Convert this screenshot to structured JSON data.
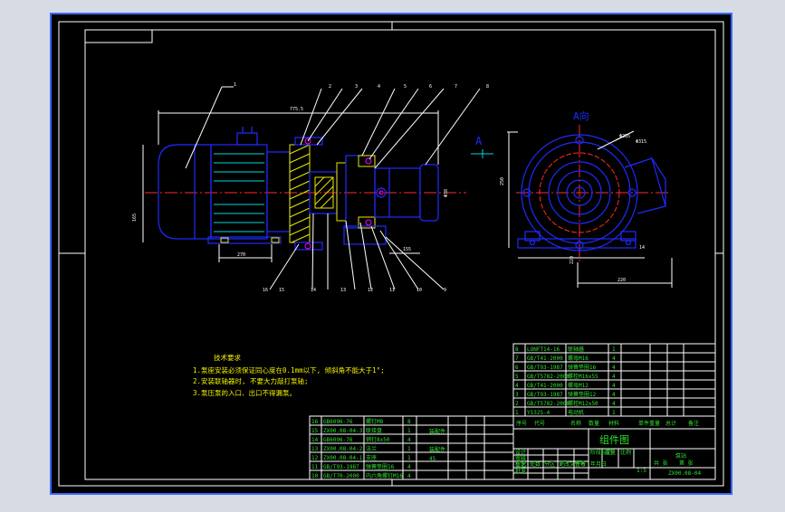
{
  "drawing": {
    "balloons": [
      "1",
      "2",
      "3",
      "4",
      "5",
      "6",
      "7",
      "8",
      "9",
      "10",
      "11",
      "12",
      "13",
      "14",
      "15",
      "16"
    ],
    "view_label": "A向",
    "view_arrow_label": "A",
    "dimensions": [
      "220",
      "Φ315",
      "Φ285",
      "Φ38",
      "220",
      "155",
      "250",
      "14"
    ],
    "left_dims": [
      "775.5",
      "165",
      "270"
    ]
  },
  "tech_notes": {
    "title": "技术要求",
    "items": [
      "1.泵座安装必须保证同心度在0.1mm以下, 倾斜角不能大于1°;",
      "2.安装联轴器时, 不要大力敲打泵轴;",
      "3.泵压泵的入口、出口不得漏泵。"
    ]
  },
  "parts_upper": [
    {
      "no": "8",
      "code": "LONFT14-16",
      "name": "联轴器",
      "qty": "1"
    },
    {
      "no": "7",
      "code": "GB/T41-2000",
      "name": "螺母M16",
      "qty": "4"
    },
    {
      "no": "6",
      "code": "GB/T93-1987",
      "name": "弹簧垫圈16",
      "qty": "4"
    },
    {
      "no": "5",
      "code": "GB/T5782-2000",
      "name": "螺栓M16x55",
      "qty": "4"
    },
    {
      "no": "4",
      "code": "GB/T41-2000",
      "name": "螺母M12",
      "qty": "4"
    },
    {
      "no": "3",
      "code": "GB/T93-1987",
      "name": "弹簧垫圈12",
      "qty": "4"
    },
    {
      "no": "2",
      "code": "GB/T5782-2000",
      "name": "螺栓M12x50",
      "qty": "4"
    },
    {
      "no": "1",
      "code": "Y132S-4",
      "name": "电动机",
      "qty": "1"
    }
  ],
  "parts_header": [
    "序号",
    "代号",
    "名称",
    "数量",
    "材料",
    "单件重量",
    "总计",
    "备注"
  ],
  "parts_lower": [
    {
      "no": "16",
      "code": "GB6096-76",
      "name": "螺钉M8",
      "qty": "8",
      "note": ""
    },
    {
      "no": "15",
      "code": "ZX00.08-04-3",
      "name": "联接盘",
      "qty": "1",
      "note": "装配件"
    },
    {
      "no": "14",
      "code": "GB6096-76",
      "name": "销钉8x50",
      "qty": "4",
      "note": ""
    },
    {
      "no": "13",
      "code": "ZX00.08-04-2",
      "name": "法兰",
      "qty": "1",
      "note": "装配件"
    },
    {
      "no": "12",
      "code": "ZX00.08-04-1",
      "name": "支座",
      "qty": "1",
      "note": "45"
    },
    {
      "no": "11",
      "code": "GB/T93-1987",
      "name": "弹簧垫圈16",
      "qty": "4",
      "note": ""
    },
    {
      "no": "10",
      "code": "GB/T70-2000",
      "name": "内六角螺钉M16",
      "qty": "4",
      "note": ""
    }
  ],
  "title_block": {
    "drawing_name": "组件图",
    "company": "泵站",
    "drawing_no": "ZX00.08-04",
    "scale": "1:5",
    "rows": [
      "标记",
      "处数",
      "分区",
      "更改文件号",
      "签名",
      "年月日"
    ],
    "roles": [
      "设计",
      "审核",
      "工艺",
      "批准"
    ],
    "labels": [
      "阶段标记",
      "重量",
      "比例",
      "共 张",
      "第 张"
    ]
  },
  "colors": {
    "background": "#000000",
    "frame": "#ffffff",
    "part_outline": "#1e2bff",
    "center_line": "#ff2a2a",
    "hatch": "#e8e800",
    "table_text": "#30e030",
    "screen_bg": "#d6dbe4"
  }
}
